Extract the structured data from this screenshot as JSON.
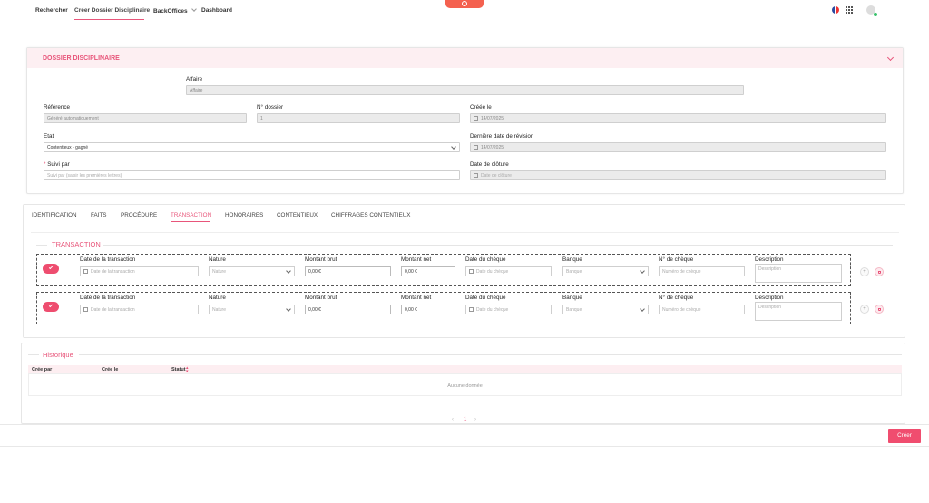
{
  "nav": {
    "items": [
      "Rechercher",
      "Créer Dossier Disciplinaire",
      "BackOffices",
      "Dashboard"
    ],
    "active": "Créer Dossier Disciplinaire"
  },
  "colors": {
    "accent": "#e8557a",
    "button": "#f04d6f",
    "header_bg": "#fdeff2"
  },
  "dossier": {
    "title": "DOSSIER DISCIPLINAIRE",
    "affaire_label": "Affaire",
    "affaire_value": "Affaire",
    "reference_label": "Référence",
    "reference_value": "Généré automatiquement",
    "numero_label": "N° dossier",
    "numero_value": "1",
    "creee_label": "Créée le",
    "creee_value": "14/07/2025",
    "etat_label": "Etat",
    "etat_value": "Contentieux - gagné",
    "revision_label": "Dernière date de révision",
    "revision_value": "14/07/2025",
    "suivi_label": "Suivi par",
    "suivi_placeholder": "Suivi par (saisir les premières lettres)",
    "cloture_label": "Date de clôture",
    "cloture_placeholder": "Date de clôture"
  },
  "tabs": [
    "IDENTIFICATION",
    "FAITS",
    "PROCÉDURE",
    "TRANSACTION",
    "HONORAIRES",
    "CONTENTIEUX",
    "CHIFFRAGES CONTENTIEUX"
  ],
  "active_tab": "TRANSACTION",
  "transaction": {
    "title": "TRANSACTION",
    "columns": [
      "Date de la transaction",
      "Nature",
      "Montant brut",
      "Montant net",
      "Date du chèque",
      "Banque",
      "N° de chèque",
      "Description"
    ],
    "placeholders": {
      "date": "Date de la transaction",
      "nature": "Nature",
      "date_cheque": "Date du chèque",
      "banque": "Banque",
      "numero_cheque": "Numéro de chèque",
      "description": "Description"
    },
    "rows": [
      {
        "montant_brut": "0,00 €",
        "montant_net": "0,00 €"
      },
      {
        "montant_brut": "0,00 €",
        "montant_net": "0,00 €"
      }
    ]
  },
  "historique": {
    "title": "Historique",
    "columns": [
      "Crée par",
      "Crée le",
      "Statut"
    ],
    "empty": "Aucune donnée",
    "page": "1",
    "prev": "‹",
    "next": "›"
  },
  "actions": {
    "create_label": "Créer"
  },
  "icons": [
    "flag-fr-icon",
    "apps-grid-icon",
    "user-avatar-icon",
    "settings-icon",
    "chevron-down-icon",
    "calendar-icon",
    "check-icon",
    "plus-icon",
    "trash-icon",
    "sort-icon"
  ]
}
